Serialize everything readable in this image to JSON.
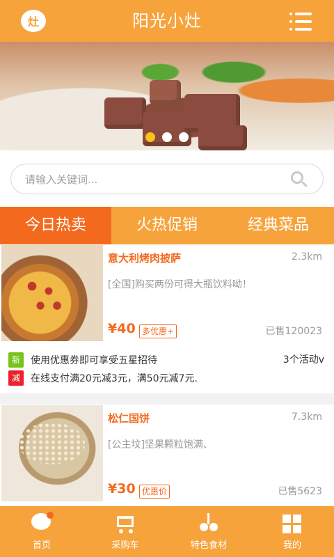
{
  "header": {
    "logo_text": "灶",
    "title": "阳光小灶",
    "menu_icon": "menu-list-icon"
  },
  "banner": {
    "slide_count": 3,
    "active_slide": 1
  },
  "search": {
    "placeholder": "请输入关键词...",
    "icon": "search-icon"
  },
  "tabs": [
    {
      "label": "今日热卖",
      "active": true
    },
    {
      "label": "火热促销",
      "active": false
    },
    {
      "label": "经典菜品",
      "active": false
    }
  ],
  "products": [
    {
      "name": "意大利烤肉披萨",
      "distance": "2.3km",
      "desc": "[全国]购买两份可得大瓶饮料呦！",
      "price": "¥40",
      "tag": "多优惠+",
      "sold": "已售120023"
    },
    {
      "name": "松仁国饼",
      "distance": "7.3km",
      "desc": "[公主坟]坚果颗粒饱满、",
      "price": "¥30",
      "tag": "优惠价",
      "sold": "已售5623"
    }
  ],
  "promos": {
    "items": [
      {
        "badge": "新",
        "text": "使用优惠券即可享受五星招待"
      },
      {
        "badge": "减",
        "text": "在线支付满20元减3元，满50元减7元."
      }
    ],
    "activity_count": "3个活动v"
  },
  "nav": [
    {
      "label": "首页",
      "icon": "chat-bubble-icon"
    },
    {
      "label": "采购车",
      "icon": "cart-icon"
    },
    {
      "label": "特色食材",
      "icon": "cherry-icon"
    },
    {
      "label": "我的",
      "icon": "grid-icon"
    }
  ],
  "colors": {
    "primary": "#f7a33c",
    "accent": "#f36a1e",
    "badge_green": "#78c21d",
    "badge_red": "#e8232c"
  }
}
